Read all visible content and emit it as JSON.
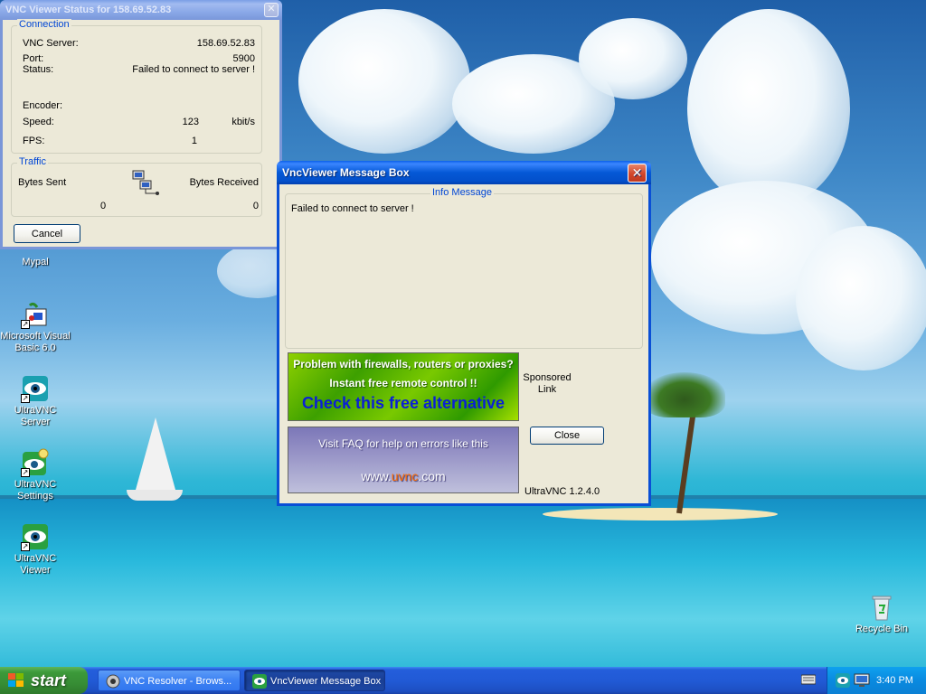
{
  "desktop_icons": [
    {
      "label": "Mypal",
      "icon": "mypal-browser-icon"
    },
    {
      "label": "Microsoft Visual Basic 6.0",
      "icon": "visual-basic-icon"
    },
    {
      "label": "UltraVNC Server",
      "icon": "ultravnc-eye-icon"
    },
    {
      "label": "UltraVNC Settings",
      "icon": "ultravnc-settings-icon"
    },
    {
      "label": "UltraVNC Viewer",
      "icon": "ultravnc-eye-icon"
    },
    {
      "label": "Recycle Bin",
      "icon": "recycle-bin-icon"
    }
  ],
  "status_window": {
    "title": "VNC Viewer Status for 158.69.52.83",
    "connection": {
      "legend": "Connection",
      "server_label": "VNC Server:",
      "server_value": "158.69.52.83",
      "port_label": "Port:",
      "port_value": "5900",
      "status_label": "Status:",
      "status_value": "Failed to connect to server !",
      "encoder_label": "Encoder:",
      "speed_label": "Speed:",
      "speed_value": "123",
      "speed_unit": "kbit/s",
      "fps_label": "FPS:",
      "fps_value": "1"
    },
    "traffic": {
      "legend": "Traffic",
      "sent_label": "Bytes Sent",
      "sent_value": "0",
      "received_label": "Bytes Received",
      "received_value": "0"
    },
    "cancel_label": "Cancel"
  },
  "message_box": {
    "title": "VncViewer Message Box",
    "info_legend": "Info Message",
    "message": "Failed to connect to server !",
    "banner1": {
      "line1": "Problem with firewalls, routers or proxies?",
      "line2": "Instant free remote control !!",
      "line3": "Check this free alternative"
    },
    "banner2": {
      "line1": "Visit FAQ for help on errors like this",
      "url_prefix": "www.",
      "url_brand": "uvnc",
      "url_suffix": ".com"
    },
    "sponsored_line1": "Sponsored",
    "sponsored_line2": "Link",
    "close_label": "Close",
    "version": "UltraVNC 1.2.4.0"
  },
  "taskbar": {
    "start_label": "start",
    "tasks": [
      {
        "label": "VNC Resolver - Brows...",
        "icon": "vnc-resolver-icon",
        "active": false
      },
      {
        "label": "VncViewer Message Box",
        "icon": "ultravnc-eye-icon",
        "active": true
      }
    ],
    "tray_icons": [
      "keyboard-icon",
      "ultravnc-tray-icon",
      "display-icon"
    ],
    "clock": "3:40 PM"
  },
  "colors": {
    "xp_blue": "#0458d6",
    "legend_blue": "#0046d5",
    "start_green": "#3c9a3a",
    "close_red": "#d2452a",
    "banner_link_blue": "#0a1fd6",
    "brand_orange": "#ff6a00"
  }
}
